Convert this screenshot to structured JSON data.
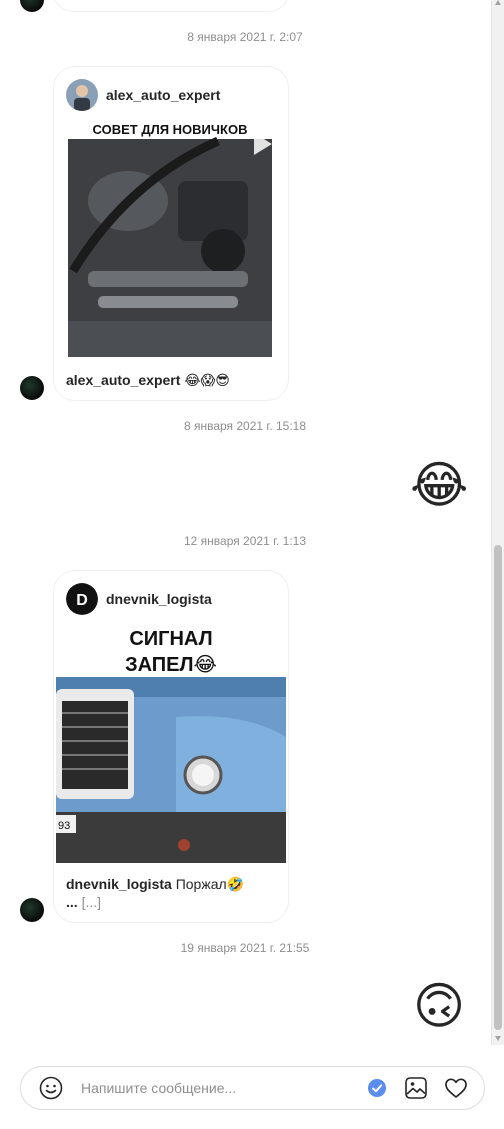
{
  "messages": [
    {
      "timestamp": "8 января 2021 г. 2:07"
    },
    {
      "timestamp": "8 января 2021 г. 15:18"
    },
    {
      "timestamp": "12 января 2021 г. 1:13"
    },
    {
      "timestamp": "19 января 2021 г. 21:55"
    }
  ],
  "posts": [
    {
      "username": "alex_auto_expert",
      "image_text": "СОВЕТ ДЛЯ НОВИЧКОВ",
      "caption_user": "alex_auto_expert",
      "caption_text": "😂😱😎"
    },
    {
      "username": "dnevnik_logista",
      "image_text_line1": "СИГНАЛ",
      "image_text_line2": "ЗАПЕЛ😂",
      "caption_user": "dnevnik_logista",
      "caption_text": "Поржал🤣",
      "caption_more": "...",
      "caption_ellipsis": "[...]"
    }
  ],
  "reactions": [
    {
      "emoji": "😂"
    },
    {
      "emoji": "🙃"
    }
  ],
  "composer": {
    "placeholder": "Напишите сообщение..."
  }
}
